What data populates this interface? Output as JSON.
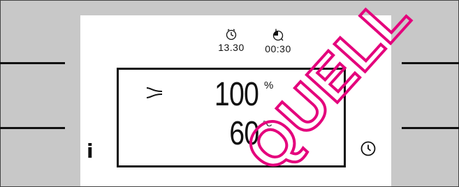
{
  "status": {
    "end_time": "13.30",
    "duration": "00:30",
    "end_time_icon": "clock-alarm-icon",
    "duration_icon": "timer-icon"
  },
  "display": {
    "mode_icon": "hot-air-mode-icon",
    "power_value": "100",
    "power_unit": "%",
    "temp_value": "60",
    "temp_unit": "°C"
  },
  "buttons": {
    "info_label": "i",
    "clock_icon": "clock-icon"
  },
  "watermark": "QUELL",
  "colors": {
    "background": "#c8c8c8",
    "panel": "#ffffff",
    "ink": "#111111",
    "watermark": "#e4007c"
  }
}
